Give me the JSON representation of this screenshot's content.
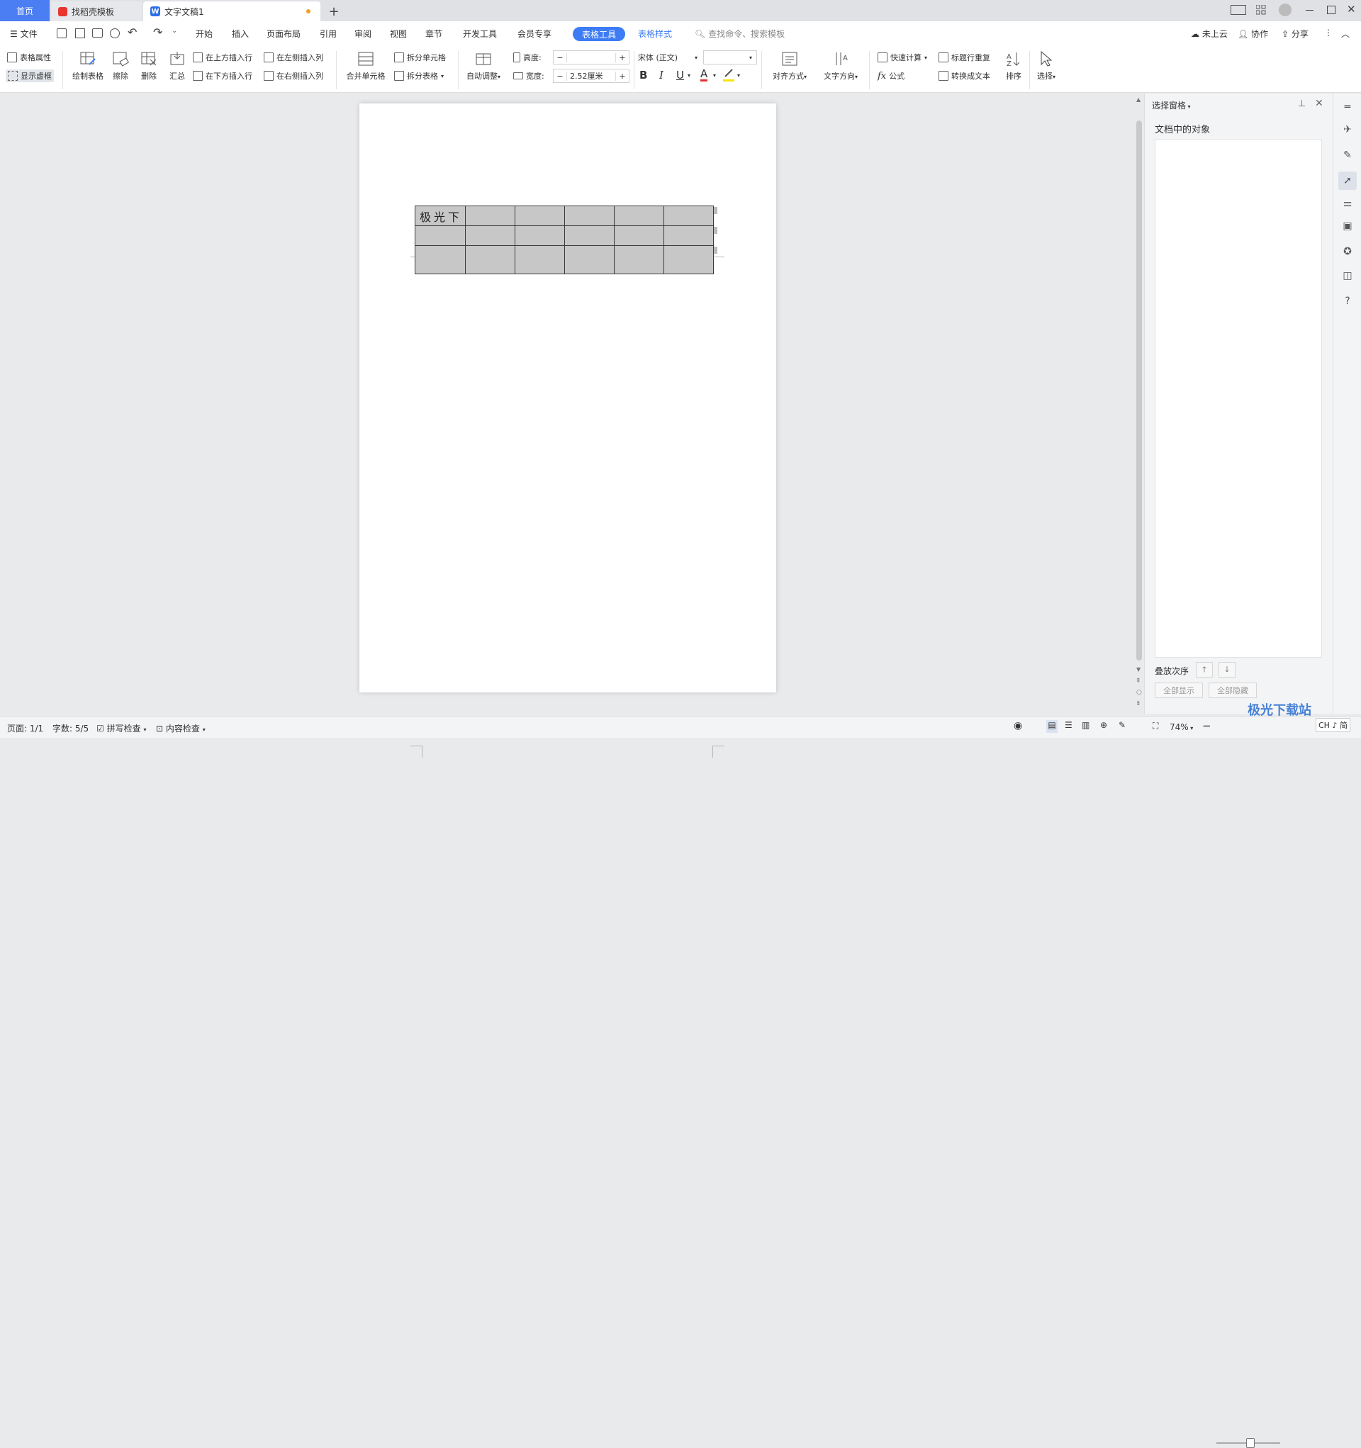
{
  "tabs": {
    "home": "首页",
    "template": "找稻壳模板",
    "document": "文字文稿1",
    "new_tab": "+"
  },
  "menu": {
    "file": "文件",
    "items": [
      "开始",
      "插入",
      "页面布局",
      "引用",
      "审阅",
      "视图",
      "章节",
      "开发工具",
      "会员专享"
    ],
    "active_tab": "表格工具",
    "table_style": "表格样式",
    "search_placeholder": "查找命令、搜索模板",
    "cloud": "未上云",
    "collab": "协作",
    "share": "分享"
  },
  "ribbon": {
    "table_props": "表格属性",
    "show_gridlines": "显示虚框",
    "draw_table": "绘制表格",
    "erase": "擦除",
    "delete": "删除",
    "summary": "汇总",
    "insert_above": "在上方插入行",
    "insert_below": "在下方插入行",
    "insert_left": "在左侧插入列",
    "insert_right": "在右侧插入列",
    "merge_cells": "合并单元格",
    "split_cells": "拆分单元格",
    "split_table": "拆分表格",
    "auto_fit": "自动调整",
    "height_label": "高度:",
    "height_value": "",
    "width_label": "宽度:",
    "width_value": "2.52厘米",
    "font_name": "宋体 (正文)",
    "font_size": "",
    "align": "对齐方式",
    "text_direction": "文字方向",
    "quick_calc": "快速计算",
    "formula": "公式",
    "header_repeat": "标题行重复",
    "to_text": "转换成文本",
    "sort": "排序",
    "select": "选择"
  },
  "document": {
    "table_cells": [
      [
        "极光下",
        "",
        "",
        "",
        "",
        ""
      ],
      [
        "",
        "",
        "",
        "",
        "",
        ""
      ],
      [
        "",
        "",
        "",
        "",
        "",
        ""
      ]
    ]
  },
  "panel": {
    "title": "选择窗格",
    "objects_label": "文档中的对象",
    "stack_order": "叠放次序",
    "show_all": "全部显示",
    "hide_all": "全部隐藏"
  },
  "status": {
    "page": "页面: 1/1",
    "words": "字数: 5/5",
    "spell_check": "拼写检查",
    "content_check": "内容检查",
    "zoom": "74%"
  },
  "watermark": "极光下载站",
  "ime": "CH ♪ 简"
}
